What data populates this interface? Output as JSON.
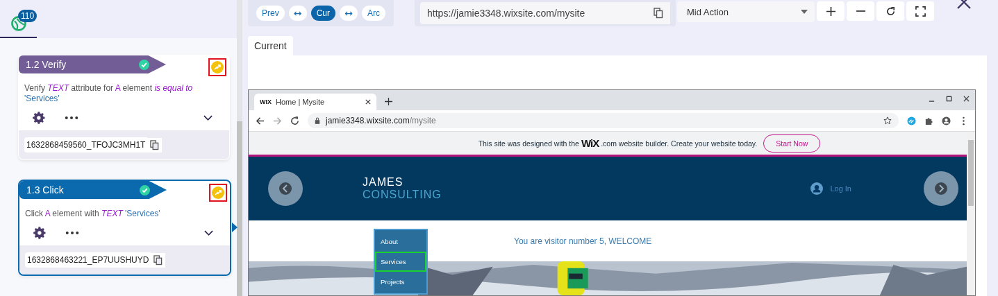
{
  "app": {
    "badge": "110"
  },
  "steps": [
    {
      "kind": "verify",
      "title": "1.2 Verify",
      "passed": true,
      "selected": false,
      "flagged": true,
      "description": [
        {
          "kind": "plain",
          "text": "Verify "
        },
        {
          "kind": "keyword",
          "text": "TEXT"
        },
        {
          "kind": "plain",
          "text": " attribute for "
        },
        {
          "kind": "element",
          "text": "A"
        },
        {
          "kind": "plain",
          "text": " element "
        },
        {
          "kind": "keyword",
          "text": "is equal to"
        },
        {
          "kind": "value",
          "text": " 'Services'"
        }
      ],
      "id": "1632868459560_TFOJC3MH1T"
    },
    {
      "kind": "click",
      "title": "1.3 Click",
      "passed": true,
      "selected": true,
      "flagged": true,
      "description": [
        {
          "kind": "plain",
          "text": "Click "
        },
        {
          "kind": "element",
          "text": "A"
        },
        {
          "kind": "plain",
          "text": " element with "
        },
        {
          "kind": "keyword",
          "text": "TEXT"
        },
        {
          "kind": "value",
          "text": " 'Services'"
        }
      ],
      "id": "1632868463221_EP7UUSHUYD"
    }
  ],
  "nav": [
    {
      "kind": "mode",
      "label": "Prev",
      "selected": false
    },
    {
      "kind": "swap",
      "label": "↔"
    },
    {
      "kind": "mode",
      "label": "Cur",
      "selected": true
    },
    {
      "kind": "swap",
      "label": "↔"
    },
    {
      "kind": "mode",
      "label": "Arc",
      "selected": false
    }
  ],
  "url": "https://jamie3348.wixsite.com/mysite",
  "action": "Mid Action",
  "tabs": [
    {
      "label": "Current",
      "selected": true
    }
  ],
  "browser": {
    "favicon": "WIX",
    "tab_title": "Home | Mysite",
    "address_host": "jamie3348.wixsite.com",
    "address_path": "/mysite",
    "banner": {
      "before": "This site was designed with the",
      "logo": "WiX",
      "after": ".com website builder. Create your website today.",
      "button": "Start Now"
    },
    "site": {
      "name": "JAMES",
      "subtitle": "CONSULTING",
      "login": "Log In",
      "visitor": "You are visitor number 5, WELCOME",
      "menu": [
        {
          "label": "About",
          "selected": false
        },
        {
          "label": "Services",
          "selected": true
        },
        {
          "label": "Projects",
          "selected": false
        }
      ]
    }
  }
}
